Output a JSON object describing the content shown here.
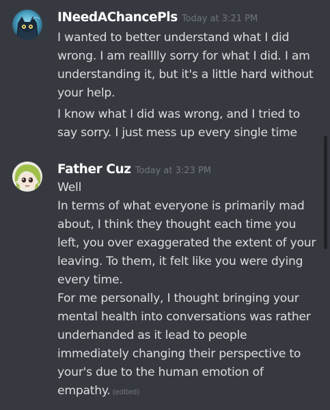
{
  "messages": [
    {
      "username": "INeedAChancePls",
      "timestamp": "Today at 3:21 PM",
      "avatar_icon": "cat-avatar-icon",
      "paragraphs": [
        "I wanted to better understand what I did wrong. I am realllly sorry for what I did. I am understanding it, but it's a little hard without your help.",
        "I know what I did was wrong, and I tried to say sorry. I just mess up every single time"
      ]
    },
    {
      "username": "Father Cuz",
      "timestamp": "Today at 3:23 PM",
      "avatar_icon": "anime-girl-avatar-icon",
      "lines": [
        "Well",
        "In terms of what everyone is primarily mad about, I think they thought each time you left, you over exaggerated the extent of your leaving. To them, it felt like you were dying every time.",
        "For me personally, I thought bringing your mental health into conversations was rather underhanded as it lead to people immediately changing their perspective to your's due to the human emotion of empathy."
      ],
      "edited_label": "(edited)"
    }
  ],
  "colors": {
    "background": "#36393f",
    "username": "#ffffff",
    "text": "#dcddde",
    "muted": "#72767d",
    "scrollbar_thumb": "#202225"
  }
}
